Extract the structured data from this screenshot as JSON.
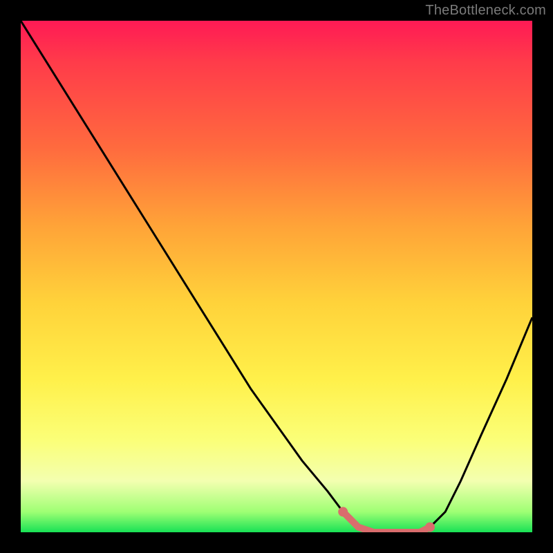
{
  "attribution": "TheBottleneck.com",
  "colors": {
    "background": "#000000",
    "curve": "#000000",
    "highlight": "#d96d6d",
    "attribution_text": "#7a7a7a"
  },
  "chart_data": {
    "type": "line",
    "title": "",
    "xlabel": "",
    "ylabel": "",
    "xlim": [
      0,
      100
    ],
    "ylim": [
      0,
      100
    ],
    "grid": false,
    "series": [
      {
        "name": "bottleneck-curve",
        "x": [
          0,
          5,
          10,
          15,
          20,
          25,
          30,
          35,
          40,
          45,
          50,
          55,
          60,
          63,
          66,
          69,
          72,
          75,
          78,
          80,
          83,
          86,
          90,
          95,
          100
        ],
        "values": [
          100,
          92,
          84,
          76,
          68,
          60,
          52,
          44,
          36,
          28,
          21,
          14,
          8,
          4,
          1,
          0,
          0,
          0,
          0,
          1,
          4,
          10,
          19,
          30,
          42
        ]
      }
    ],
    "highlight_region": {
      "x_start": 63,
      "x_end": 80
    },
    "annotations": []
  }
}
